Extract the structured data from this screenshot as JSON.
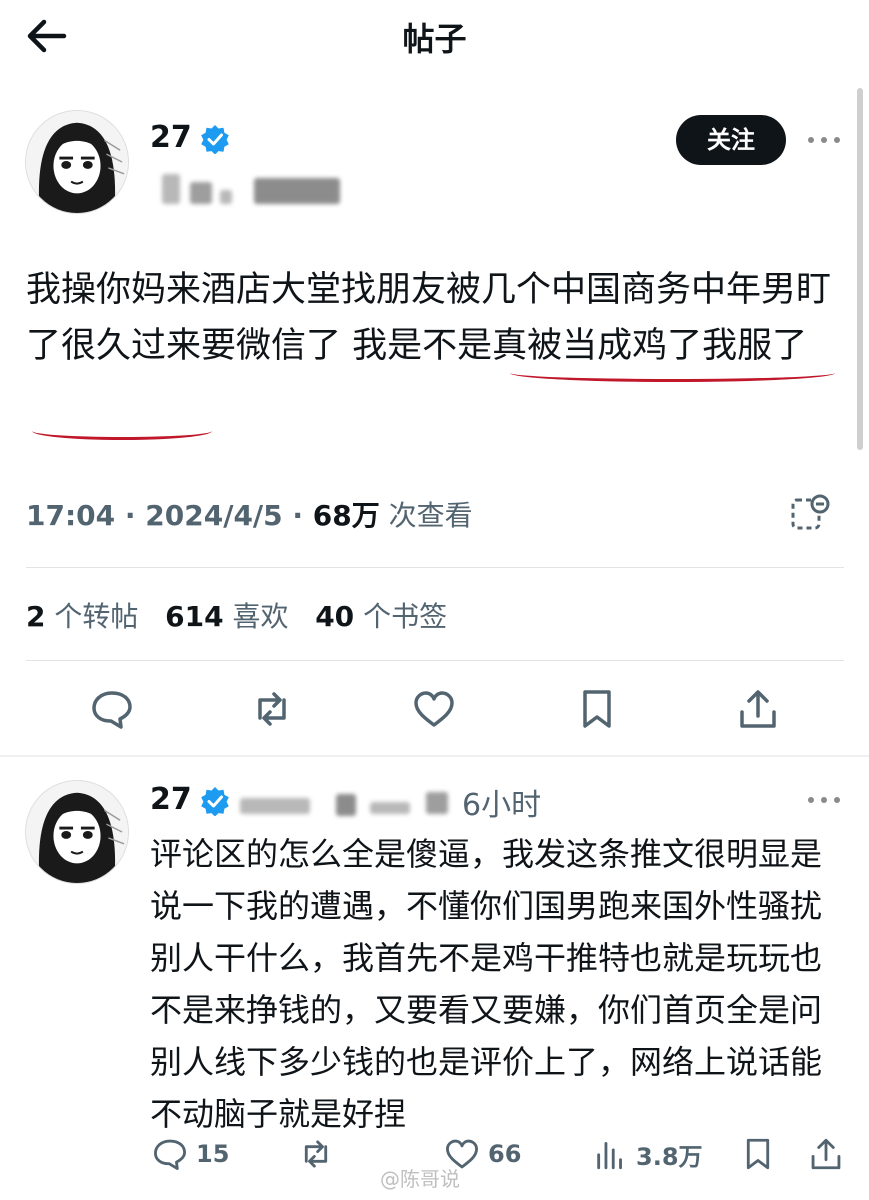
{
  "header": {
    "title": "帖子",
    "back_icon": "arrow-left-icon"
  },
  "post": {
    "author_name": "27",
    "follow_label": "关注",
    "text": "我操你妈来酒店大堂找朋友被几个中国商务中年男盯了很久过来要微信了 我是不是真被当成鸡了我服了",
    "time": "17:04",
    "date": "2024/4/5",
    "views_count": "68万",
    "views_label": "次查看",
    "reposts_count": "2",
    "reposts_label": "个转帖",
    "likes_count": "614",
    "likes_label": "喜欢",
    "bookmarks_count": "40",
    "bookmarks_label": "个书签"
  },
  "reply": {
    "author_name": "27",
    "time": "6小时",
    "text": "评论区的怎么全是傻逼，我发这条推文很明显是说一下我的遭遇，不懂你们国男跑来国外性骚扰别人干什么，我首先不是鸡干推特也就是玩玩也不是来挣钱的，又要看又要嫌，你们首页全是问别人线下多少钱的也是评价上了，网络上说话能不动脑子就是好捏",
    "reply_count": "15",
    "like_count": "66",
    "view_count": "3.8万"
  },
  "watermark": "@陈哥说",
  "colors": {
    "accent": "#1d9bf0",
    "text": "#0f1419",
    "muted": "#536471",
    "underline": "#c0182a"
  }
}
